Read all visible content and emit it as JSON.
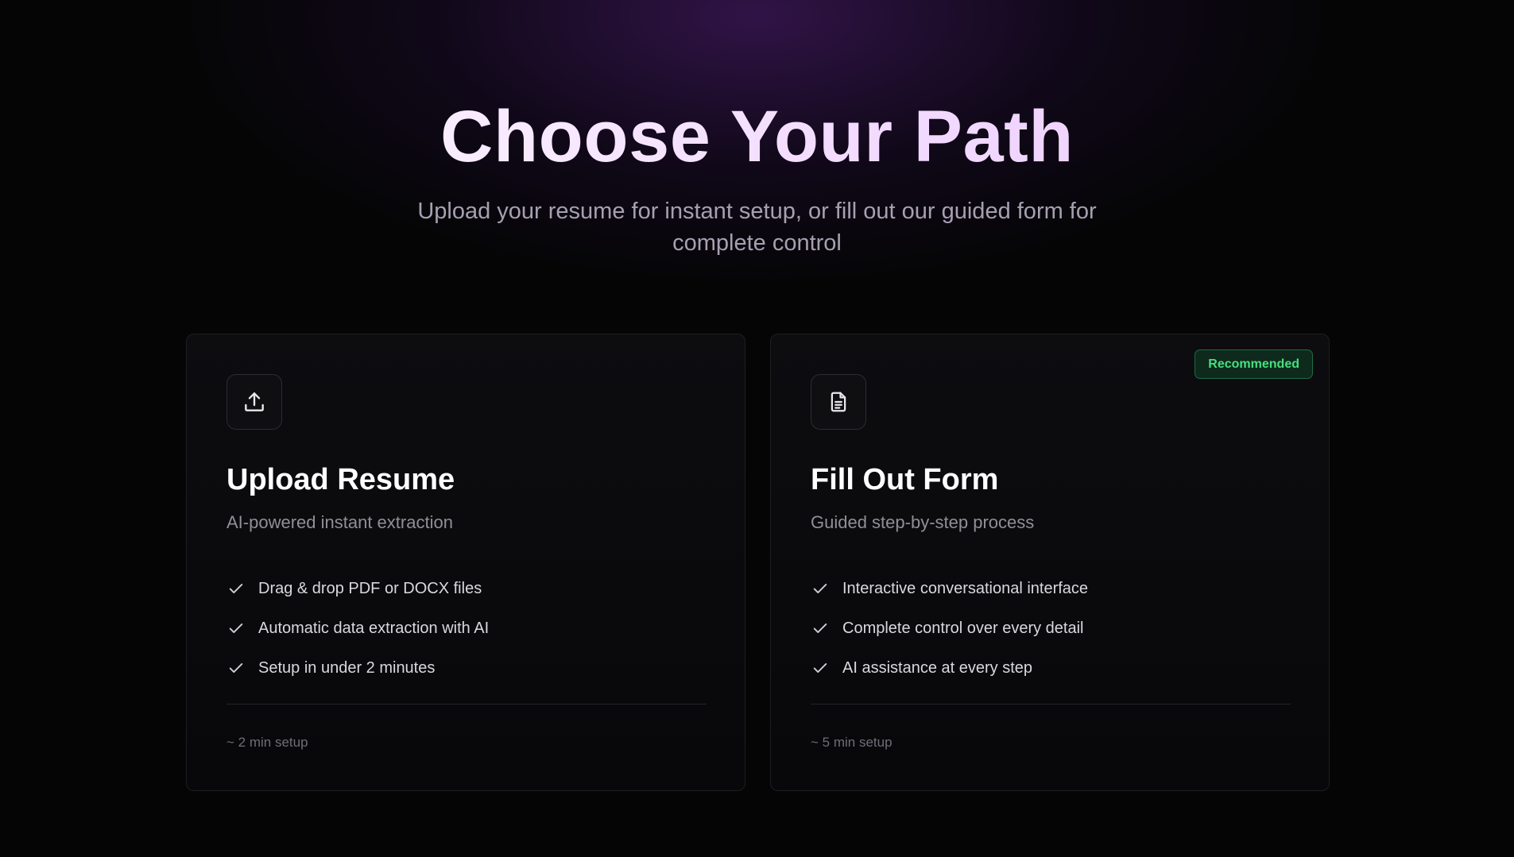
{
  "hero": {
    "title": "Choose Your Path",
    "subtitle": "Upload your resume for instant setup, or fill out our guided form for complete control"
  },
  "cards": [
    {
      "icon": "upload-icon",
      "title": "Upload Resume",
      "subtitle": "AI-powered instant extraction",
      "features": [
        "Drag & drop PDF or DOCX files",
        "Automatic data extraction with AI",
        "Setup in under 2 minutes"
      ],
      "setup_time": "~ 2 min setup"
    },
    {
      "icon": "document-icon",
      "badge": "Recommended",
      "title": "Fill Out Form",
      "subtitle": "Guided step-by-step process",
      "features": [
        "Interactive conversational interface",
        "Complete control over every detail",
        "AI assistance at every step"
      ],
      "setup_time": "~ 5 min setup"
    }
  ],
  "colors": {
    "background": "#050506",
    "accent_glow": "#381652",
    "badge_text": "#4ade80",
    "badge_bg": "#0d2a1d"
  }
}
